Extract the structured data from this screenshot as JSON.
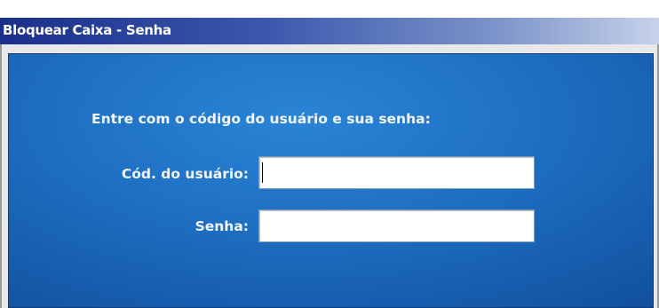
{
  "window": {
    "title": "Bloquear Caixa - Senha"
  },
  "form": {
    "instruction": "Entre com o código do usuário e sua senha:",
    "user_code_label": "Cód. do usuário:",
    "user_code_value": "",
    "password_label": "Senha:",
    "password_value": ""
  },
  "colors": {
    "title_bar_start": "#1a2f8a",
    "panel_blue": "#1e6fc2",
    "text": "#f2f6ff"
  }
}
